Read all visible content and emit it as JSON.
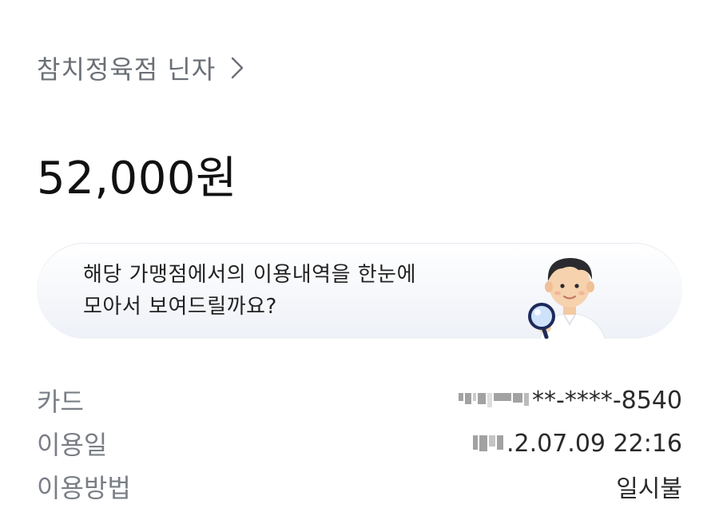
{
  "merchant": {
    "name": "참치정육점 닌자",
    "chevron_icon": "chevron-right-icon"
  },
  "payment": {
    "amount": "52,000원"
  },
  "banner": {
    "line1": "해당 가맹점에서의 이용내역을 한눈에",
    "line2": "모아서 보여드릴까요?",
    "illustration_icon": "person-magnifier-icon"
  },
  "details": [
    {
      "label": "카드",
      "value": "**-****-8540",
      "masked": true
    },
    {
      "label": "이용일",
      "value": ".2.07.09 22:16",
      "masked": true
    },
    {
      "label": "이용방법",
      "value": "일시불",
      "masked": false
    }
  ],
  "colors": {
    "label_gray": "#7a7e85",
    "banner_bg": "#eef1f7"
  }
}
